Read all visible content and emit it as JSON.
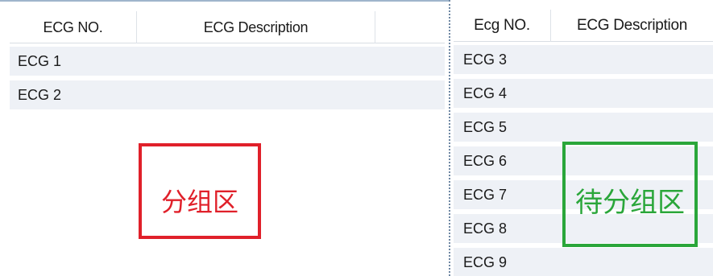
{
  "grouped_area": {
    "columns": [
      "ECG NO.",
      "ECG Description",
      ""
    ],
    "rows": [
      "ECG 1",
      "ECG 2"
    ],
    "annotation": "分组区",
    "annotation_color": "#e0202a"
  },
  "pending_area": {
    "columns": [
      "Ecg NO.",
      "ECG Description"
    ],
    "rows": [
      "ECG 3",
      "ECG 4",
      "ECG 5",
      "ECG 6",
      "ECG 7",
      "ECG 8",
      "ECG 9"
    ],
    "annotation": "待分组区",
    "annotation_color": "#2aa63a"
  },
  "colors": {
    "row_background": "#eef1f6",
    "splitter": "#6e87a3"
  }
}
